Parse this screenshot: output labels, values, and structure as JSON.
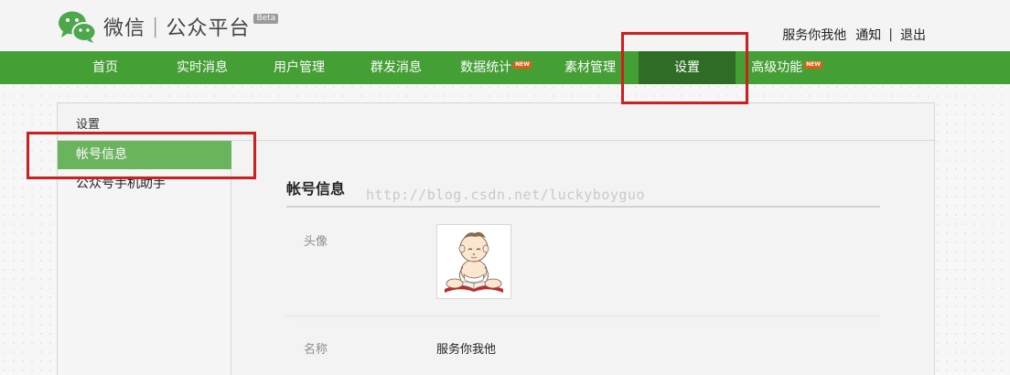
{
  "header": {
    "brand_name": "微信",
    "brand_sub": "公众平台",
    "beta": "Beta",
    "user_name": "服务你我他",
    "notify": "通知",
    "logout": "退出"
  },
  "nav": {
    "items": [
      {
        "label": "首页"
      },
      {
        "label": "实时消息"
      },
      {
        "label": "用户管理"
      },
      {
        "label": "群发消息"
      },
      {
        "label": "数据统计",
        "badge": "NEW"
      },
      {
        "label": "素材管理"
      },
      {
        "label": "设置",
        "active": true
      },
      {
        "label": "高级功能",
        "badge": "NEW"
      }
    ]
  },
  "panel": {
    "title": "设置"
  },
  "sidebar": {
    "items": [
      {
        "label": "帐号信息",
        "active": true
      },
      {
        "label": "公众号手机助手"
      }
    ]
  },
  "content": {
    "section_title": "帐号信息",
    "watermark": "http://blog.csdn.net/luckyboyguo",
    "avatar_label": "头像",
    "name_label": "名称",
    "name_value": "服务你我他"
  },
  "colors": {
    "nav_bg": "#44a035",
    "nav_active": "#2f6d26",
    "side_active": "#6bb45e",
    "highlight": "#d11f1f",
    "new_badge": "#e65a12"
  },
  "icons": {
    "logo": "wechat-logo-icon",
    "avatar": "baby-reading-avatar"
  }
}
